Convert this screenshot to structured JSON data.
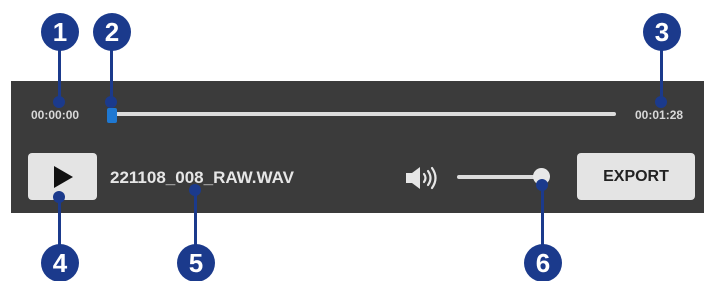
{
  "player": {
    "current_time": "00:00:00",
    "total_time": "00:01:28",
    "seek_position_fraction": 0.0,
    "filename": "221108_008_RAW.WAV",
    "volume_fraction": 1.0,
    "export_label": "EXPORT"
  },
  "icons": {
    "play": "play-icon",
    "volume": "speaker-volume-icon"
  },
  "callouts": [
    {
      "number": "1"
    },
    {
      "number": "2"
    },
    {
      "number": "3"
    },
    {
      "number": "4"
    },
    {
      "number": "5"
    },
    {
      "number": "6"
    }
  ],
  "colors": {
    "panel_bg": "#3b3b3b",
    "seek_handle": "#1e78d2",
    "callout": "#1b3a8c",
    "button_bg": "#e4e4e4"
  }
}
